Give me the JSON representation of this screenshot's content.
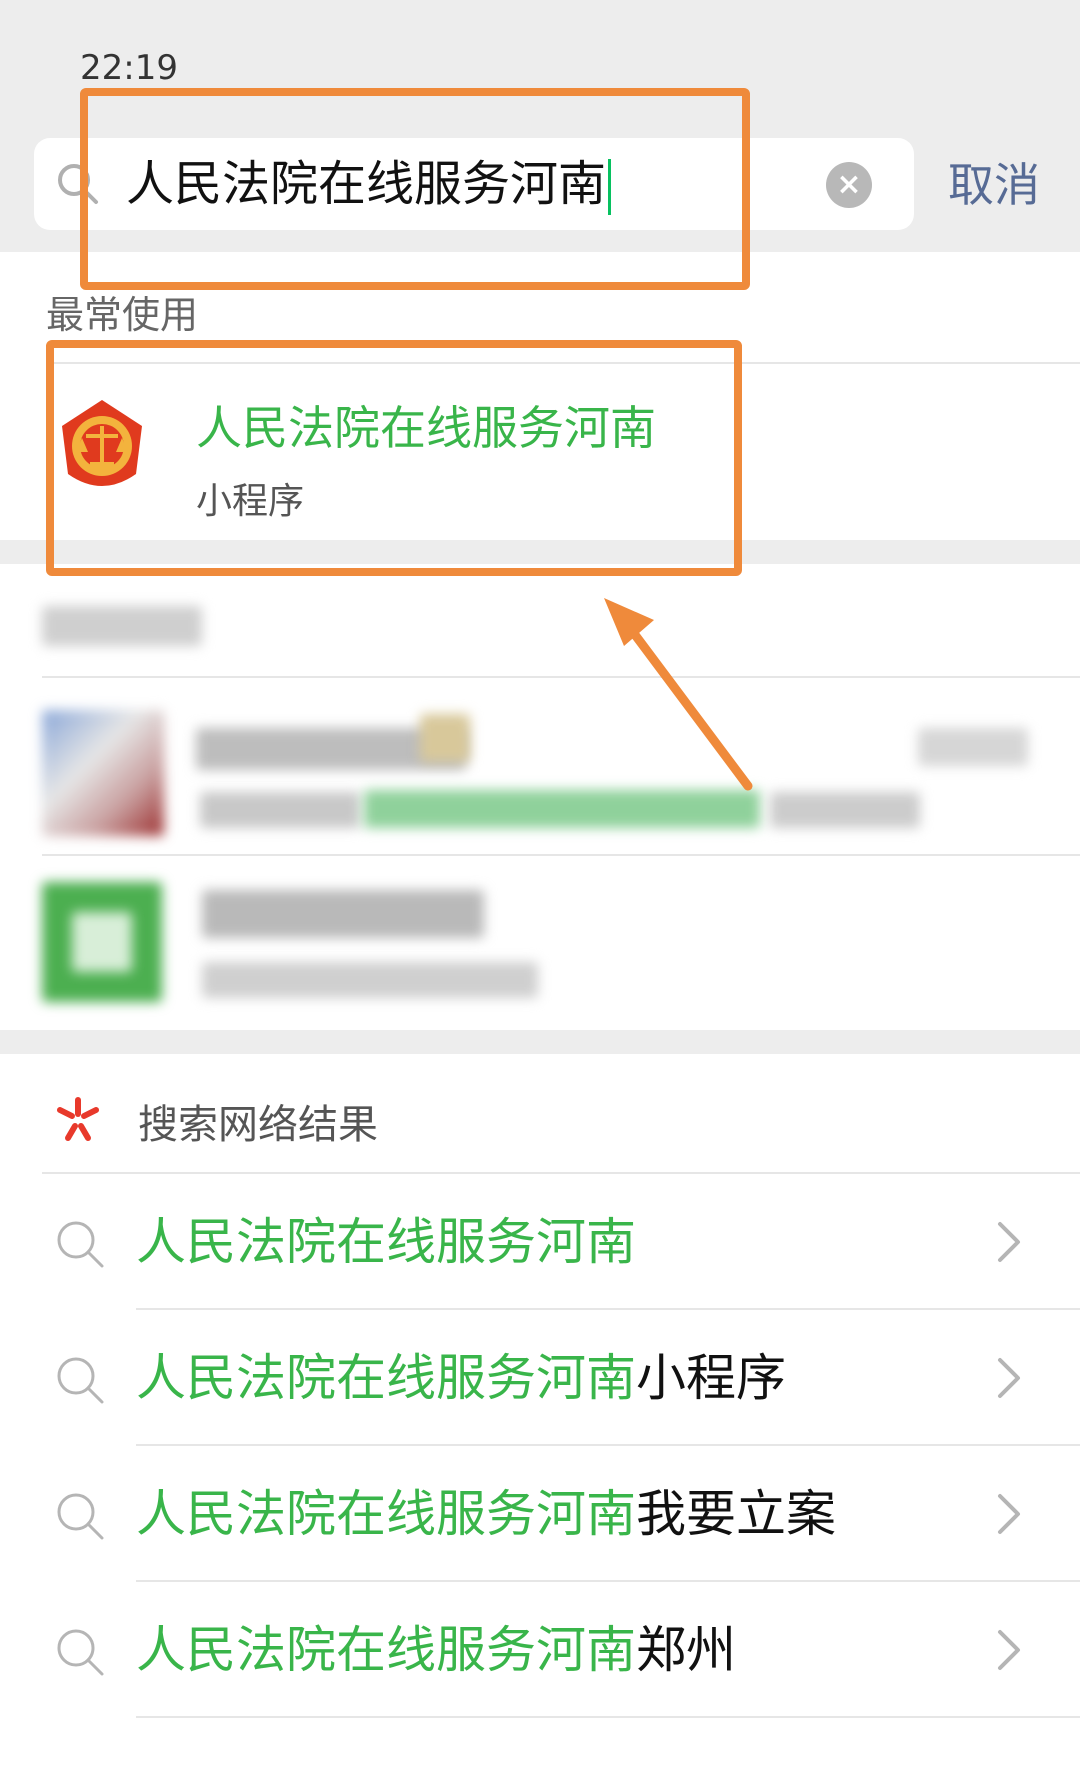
{
  "status_bar": {
    "time": "22:19"
  },
  "search": {
    "query": "人民法院在线服务河南",
    "cancel_label": "取消"
  },
  "frequent": {
    "section_title": "最常使用",
    "item": {
      "title": "人民法院在线服务河南",
      "subtitle": "小程序"
    }
  },
  "web_results": {
    "section_title": "搜索网络结果",
    "suggestions": [
      {
        "highlight": "人民法院在线服务河南",
        "suffix": ""
      },
      {
        "highlight": "人民法院在线服务河南",
        "suffix": "小程序"
      },
      {
        "highlight": "人民法院在线服务河南",
        "suffix": "我要立案"
      },
      {
        "highlight": "人民法院在线服务河南",
        "suffix": "郑州"
      }
    ]
  },
  "colors": {
    "accent_green": "#39b54a",
    "cancel_blue": "#576b95",
    "annotation_orange": "#ef8a3b"
  }
}
